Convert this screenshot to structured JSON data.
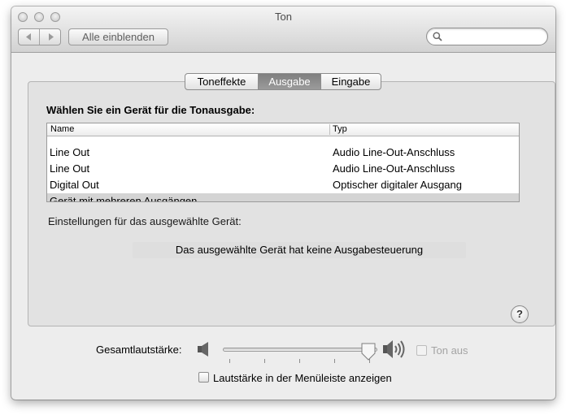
{
  "window": {
    "title": "Ton"
  },
  "toolbar": {
    "back_icon": "chevron-left-icon",
    "forward_icon": "chevron-right-icon",
    "show_all_label": "Alle einblenden",
    "search": {
      "value": "",
      "placeholder": ""
    }
  },
  "tabs": [
    {
      "label": "Toneffekte",
      "active": false
    },
    {
      "label": "Ausgabe",
      "active": true
    },
    {
      "label": "Eingabe",
      "active": false
    }
  ],
  "output": {
    "prompt": "Wählen Sie ein Gerät für die Tonausgabe:",
    "columns": [
      "Name",
      "Typ"
    ],
    "devices": [
      {
        "name": "Line Out",
        "type": "Audio Line-Out-Anschluss",
        "selected": false
      },
      {
        "name": "Line Out",
        "type": "Audio Line-Out-Anschluss",
        "selected": false
      },
      {
        "name": "Digital Out",
        "type": "Optischer digitaler Ausgang",
        "selected": false
      },
      {
        "name": "Gerät mit mehreren Ausgängen",
        "type": "",
        "selected": true
      }
    ],
    "settings_label": "Einstellungen für das ausgewählte Gerät:",
    "no_control_text": "Das ausgewählte Gerät hat keine Ausgabesteuerung"
  },
  "help": {
    "label": "?"
  },
  "volume": {
    "label": "Gesamtlautstärke:",
    "level": 0.94,
    "mute_label": "Ton aus",
    "mute_checked": false,
    "mute_enabled": false,
    "show_in_menubar_label": "Lautstärke in der Menüleiste anzeigen",
    "show_in_menubar_checked": false
  },
  "colors": {
    "window_bg": "#ededed",
    "panel_bg": "#e2e2e2",
    "selected_row": "#d4d4d4",
    "active_tab": "#8a8a8a"
  }
}
